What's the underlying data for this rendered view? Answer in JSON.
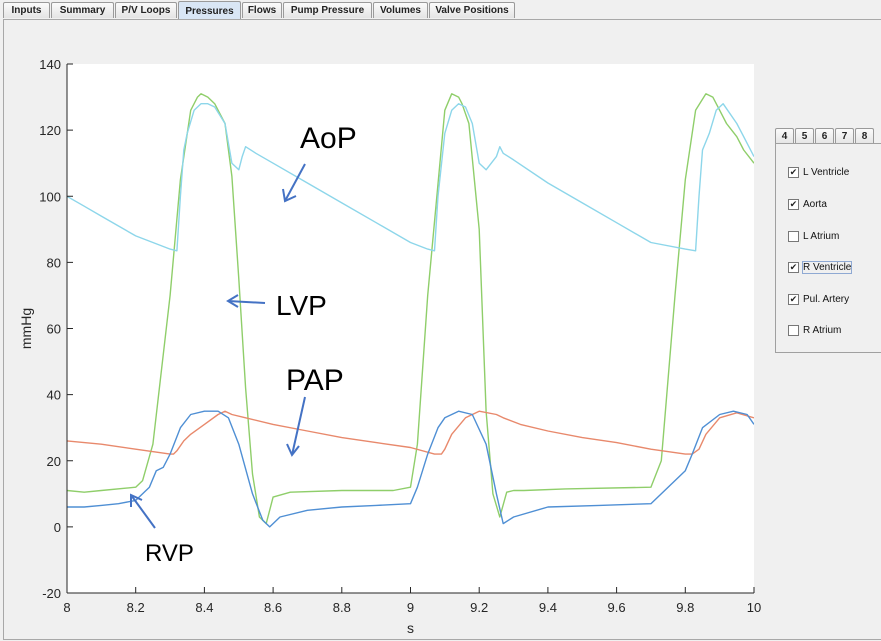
{
  "tabs": [
    {
      "label": "Inputs",
      "active": false
    },
    {
      "label": "Summary",
      "active": false
    },
    {
      "label": "P/V Loops",
      "active": false
    },
    {
      "label": "Pressures",
      "active": true
    },
    {
      "label": "Flows",
      "active": false
    },
    {
      "label": "Pump Pressure",
      "active": false
    },
    {
      "label": "Volumes",
      "active": false
    },
    {
      "label": "Valve Positions",
      "active": false
    }
  ],
  "side_tabs": [
    "4",
    "5",
    "6",
    "7",
    "8"
  ],
  "checkboxes": [
    {
      "label": "L Ventricle",
      "checked": true
    },
    {
      "label": "Aorta",
      "checked": true
    },
    {
      "label": "L Atrium",
      "checked": false
    },
    {
      "label": "R Ventricle",
      "checked": true
    },
    {
      "label": "Pul. Artery",
      "checked": true
    },
    {
      "label": "R Atrium",
      "checked": false
    }
  ],
  "annotations": {
    "aop": "AoP",
    "lvp": "LVP",
    "pap": "PAP",
    "rvp": "RVP"
  },
  "chart_data": {
    "type": "line",
    "title": "",
    "xlabel": "s",
    "ylabel": "mmHg",
    "xlim": [
      8,
      10
    ],
    "ylim": [
      -20,
      140
    ],
    "xticks": [
      8,
      8.2,
      8.4,
      8.6,
      8.8,
      9,
      9.2,
      9.4,
      9.6,
      9.8,
      10
    ],
    "yticks": [
      -20,
      0,
      20,
      40,
      60,
      80,
      100,
      120,
      140
    ],
    "grid": false,
    "series": [
      {
        "color": "#8fce6a",
        "x": [
          8,
          8.05,
          8.1,
          8.2,
          8.22,
          8.25,
          8.3,
          8.33,
          8.36,
          8.38,
          8.39,
          8.41,
          8.43,
          8.46,
          8.48,
          8.5,
          8.52,
          8.54,
          8.56,
          8.58,
          8.6,
          8.65,
          8.8,
          8.95,
          9,
          9.02,
          9.05,
          9.1,
          9.12,
          9.14,
          9.15,
          9.17,
          9.2,
          9.22,
          9.24,
          9.26,
          9.28,
          9.3,
          9.33,
          9.45,
          9.7,
          9.73,
          9.77,
          9.8,
          9.83,
          9.86,
          9.88,
          9.9,
          9.92,
          9.95,
          9.97,
          10
        ],
        "y": [
          11,
          10.5,
          11,
          12,
          14,
          25,
          70,
          105,
          126,
          130,
          131,
          130,
          128,
          122,
          106,
          75,
          42,
          16,
          3,
          1,
          9,
          10.5,
          11,
          11,
          12,
          25,
          70,
          126,
          131,
          130,
          128,
          122,
          90,
          35,
          10,
          3,
          10.5,
          11,
          11,
          11.5,
          12,
          20,
          70,
          105,
          126,
          131,
          130,
          126,
          122,
          118,
          114,
          110
        ]
      },
      {
        "color": "#8dd6ea",
        "x": [
          8,
          8.05,
          8.1,
          8.15,
          8.2,
          8.25,
          8.3,
          8.32,
          8.33,
          8.34,
          8.35,
          8.37,
          8.39,
          8.41,
          8.43,
          8.46,
          8.48,
          8.5,
          8.51,
          8.52,
          8.55,
          8.6,
          8.7,
          8.8,
          8.9,
          9,
          9.05,
          9.07,
          9.08,
          9.1,
          9.12,
          9.14,
          9.16,
          9.18,
          9.2,
          9.22,
          9.25,
          9.26,
          9.27,
          9.3,
          9.4,
          9.5,
          9.6,
          9.7,
          9.8,
          9.83,
          9.84,
          9.85,
          9.87,
          9.89,
          9.91,
          9.95,
          9.97,
          10
        ],
        "y": [
          100,
          97,
          94,
          91,
          88,
          86,
          84,
          83.5,
          100,
          114,
          119,
          126,
          128,
          128,
          127,
          122,
          110,
          108,
          112,
          115,
          113,
          110,
          104,
          98,
          92,
          86,
          84,
          83.5,
          100,
          119,
          126,
          128,
          127,
          122,
          110,
          108,
          112,
          115,
          113,
          111,
          104,
          98,
          92,
          86,
          84,
          83.5,
          100,
          114,
          119,
          126,
          128,
          122,
          118,
          112
        ]
      },
      {
        "color": "#e8896c",
        "x": [
          8,
          8.1,
          8.2,
          8.3,
          8.31,
          8.32,
          8.34,
          8.36,
          8.4,
          8.44,
          8.46,
          8.48,
          8.52,
          8.6,
          8.7,
          8.8,
          8.9,
          9,
          9.07,
          9.09,
          9.1,
          9.12,
          9.16,
          9.2,
          9.25,
          9.27,
          9.32,
          9.4,
          9.5,
          9.6,
          9.7,
          9.8,
          9.82,
          9.84,
          9.86,
          9.9,
          9.95,
          10
        ],
        "y": [
          26,
          25,
          23.5,
          22,
          22,
          23,
          26,
          28,
          31,
          34,
          35,
          34,
          33,
          31,
          29,
          27,
          25.5,
          24,
          22,
          22,
          23.5,
          28,
          33,
          35,
          34,
          33,
          31,
          29,
          27,
          25.5,
          23.5,
          22,
          22,
          23.5,
          28,
          33,
          34.5,
          33
        ]
      },
      {
        "color": "#4f8fd4",
        "x": [
          8,
          8.05,
          8.1,
          8.15,
          8.2,
          8.24,
          8.26,
          8.28,
          8.3,
          8.33,
          8.36,
          8.4,
          8.44,
          8.47,
          8.5,
          8.54,
          8.57,
          8.59,
          8.62,
          8.7,
          8.8,
          8.9,
          9,
          9.02,
          9.05,
          9.08,
          9.1,
          9.14,
          9.18,
          9.22,
          9.25,
          9.27,
          9.3,
          9.4,
          9.55,
          9.7,
          9.75,
          9.8,
          9.82,
          9.85,
          9.9,
          9.94,
          9.98,
          10
        ],
        "y": [
          6,
          6,
          6.5,
          7,
          8,
          12,
          17,
          18,
          22,
          30,
          34,
          35,
          35,
          33,
          25,
          10,
          2,
          0,
          3,
          5,
          6,
          6.5,
          7,
          12,
          22,
          30,
          33,
          35,
          34,
          25,
          10,
          1,
          3,
          6,
          6.5,
          7,
          12,
          17,
          22,
          30,
          34,
          35,
          34,
          31
        ]
      }
    ]
  }
}
